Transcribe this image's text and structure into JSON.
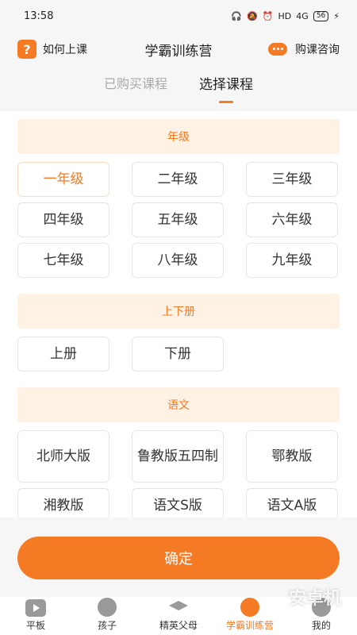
{
  "status_bar": {
    "time": "13:58",
    "icons": "HD",
    "network": "4G",
    "battery": "56"
  },
  "header": {
    "left_label": "如何上课",
    "title": "学霸训练营",
    "right_label": "购课咨询"
  },
  "tabs": [
    {
      "label": "已购买课程",
      "active": false
    },
    {
      "label": "选择课程",
      "active": true
    }
  ],
  "sections": {
    "grade": {
      "title": "年级",
      "options": [
        "一年级",
        "二年级",
        "三年级",
        "四年级",
        "五年级",
        "六年级",
        "七年级",
        "八年级",
        "九年级"
      ],
      "selected": "一年级"
    },
    "volume": {
      "title": "上下册",
      "options": [
        "上册",
        "下册"
      ]
    },
    "chinese": {
      "title": "语文",
      "options": [
        "北师大版",
        "鲁教版五四制",
        "鄂教版",
        "湘教版",
        "语文S版",
        "语文A版"
      ]
    }
  },
  "confirm_label": "确定",
  "bottom_nav": [
    {
      "label": "平板",
      "icon": "play-icon"
    },
    {
      "label": "孩子",
      "icon": "smile-icon"
    },
    {
      "label": "精英父母",
      "icon": "graduation-cap-icon"
    },
    {
      "label": "学霸训练营",
      "icon": "trophy-icon",
      "active": true
    },
    {
      "label": "我的",
      "icon": "person-icon"
    }
  ],
  "watermark": "安卓机",
  "colors": {
    "accent": "#f47a23",
    "section_bg": "#fff1e3"
  }
}
